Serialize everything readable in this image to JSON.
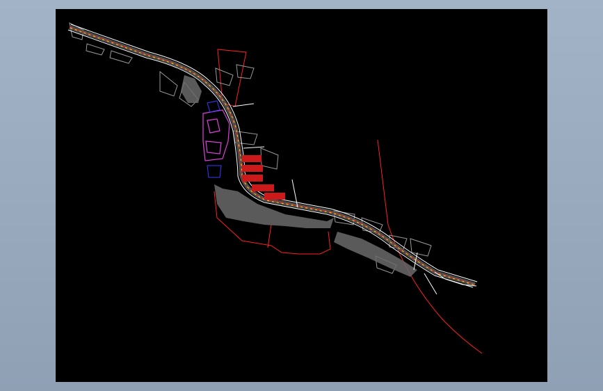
{
  "viewer": {
    "background": "#a3b3c7",
    "canvas_color": "#000000"
  },
  "drawing": {
    "road_color": "#ffffff",
    "centerline_color": "#ffd400",
    "boundary_color": "#ff2020",
    "building_color": "#9a9a9a",
    "site_color": "#e040e0",
    "secondary_color": "#3a3aff"
  }
}
